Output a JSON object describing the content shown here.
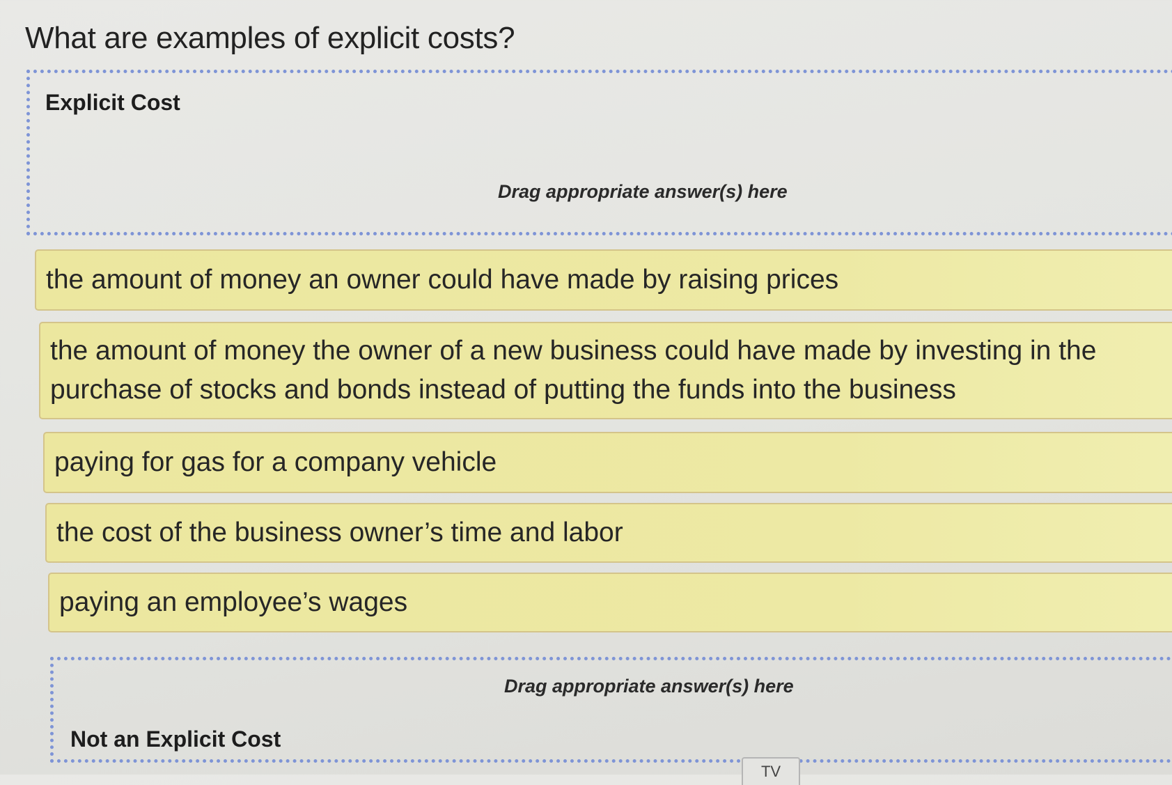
{
  "question": "What are examples of explicit costs?",
  "zones": {
    "explicit": {
      "title": "Explicit Cost",
      "hint": "Drag appropriate answer(s) here"
    },
    "not_explicit": {
      "title": "Not an Explicit Cost",
      "hint": "Drag appropriate answer(s) here"
    }
  },
  "answers": [
    "the amount of money an owner could have made by raising prices",
    "the amount of money the owner of a new business could have made by investing in the purchase of stocks and bonds instead of putting the funds into the business",
    "paying for gas for a company vehicle",
    "the cost of the business owner’s time and labor",
    "paying an employee’s wages"
  ],
  "footer": {
    "tab_label": "TV"
  },
  "colors": {
    "card_fill": "#ede9a4",
    "card_border": "#d4c48a",
    "dropzone_border": "#7e94d6",
    "background": "#e6e6e3"
  }
}
